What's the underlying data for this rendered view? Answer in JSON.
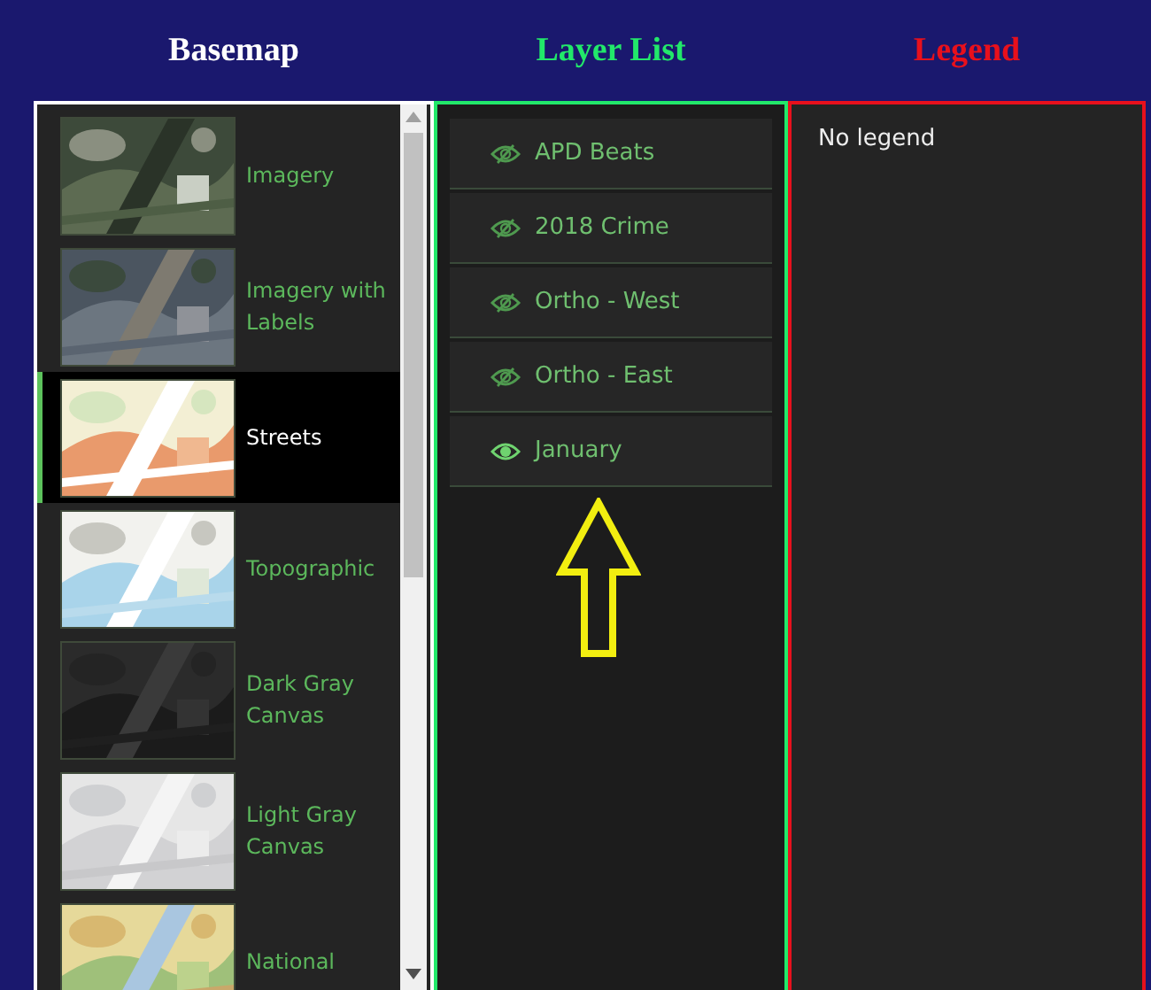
{
  "headings": [
    {
      "text": "Basemap",
      "color": "#ffffff"
    },
    {
      "text": "Layer List",
      "color": "#22e86a"
    },
    {
      "text": "Legend",
      "color": "#e8101c"
    }
  ],
  "basemaps": [
    {
      "title": "Imagery",
      "selected": false
    },
    {
      "title": "Imagery with Labels",
      "selected": false
    },
    {
      "title": "Streets",
      "selected": true
    },
    {
      "title": "Topographic",
      "selected": false
    },
    {
      "title": "Dark Gray Canvas",
      "selected": false
    },
    {
      "title": "Light Gray Canvas",
      "selected": false
    },
    {
      "title": "National",
      "selected": false
    }
  ],
  "layers": [
    {
      "title": "APD Beats",
      "visible": false
    },
    {
      "title": "2018 Crime",
      "visible": false
    },
    {
      "title": "Ortho - West",
      "visible": false
    },
    {
      "title": "Ortho - East",
      "visible": false
    },
    {
      "title": "January",
      "visible": true
    }
  ],
  "legend": {
    "message": "No legend"
  }
}
